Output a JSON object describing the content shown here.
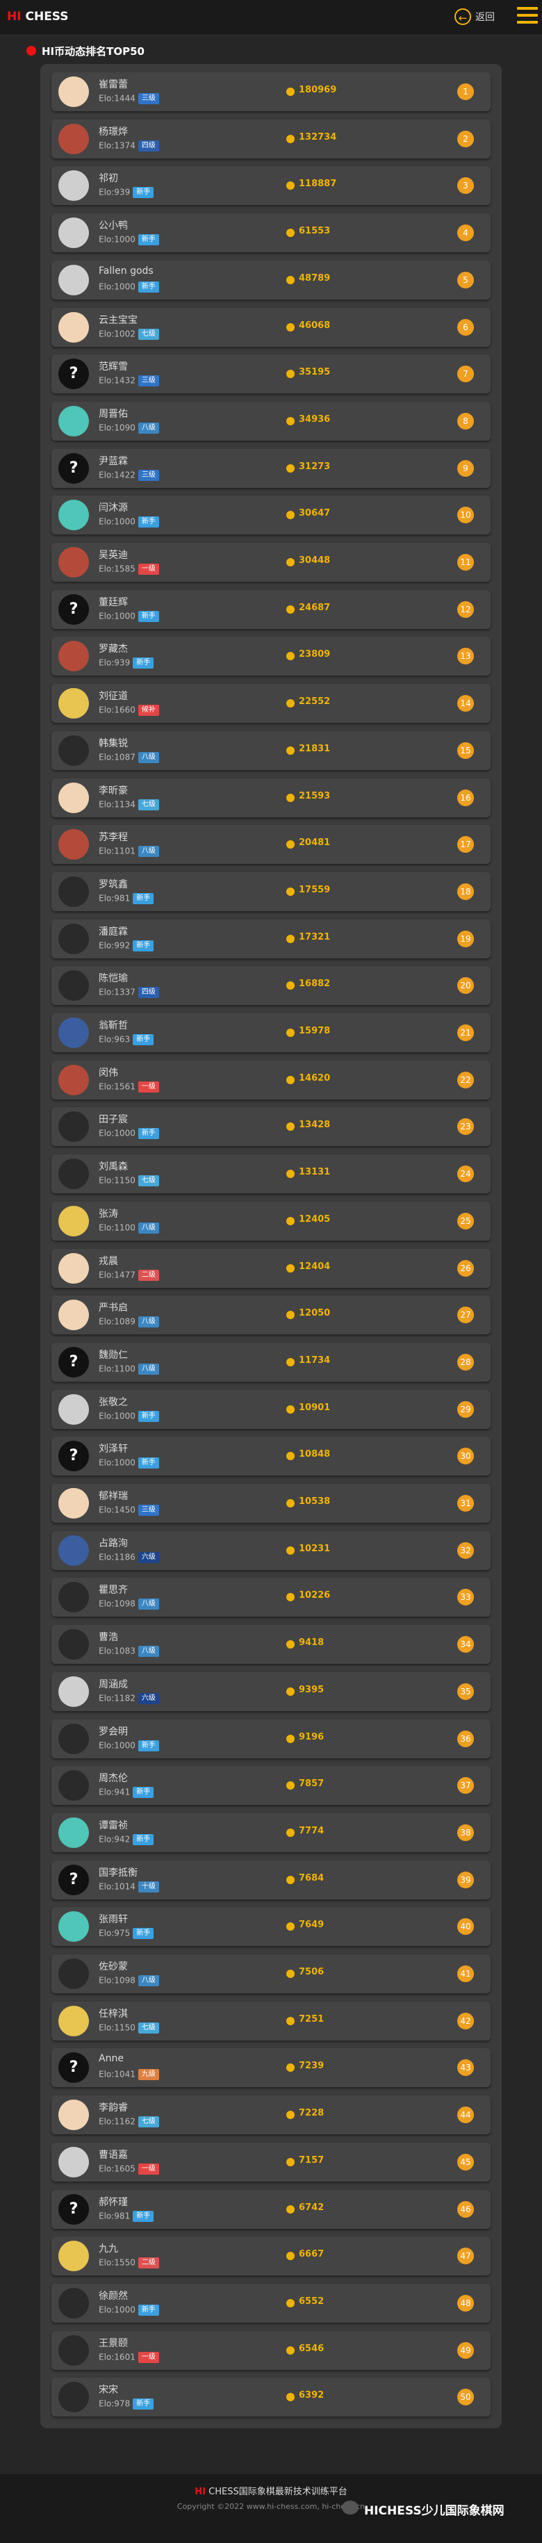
{
  "header": {
    "logo_hi": "HI",
    "logo_rest": "CHESS",
    "back_label": "返回",
    "back_icon": "back-arrow-icon",
    "menu_icon": "menu-icon"
  },
  "section": {
    "title": "HI币动态排名TOP50"
  },
  "players": [
    {
      "name": "崔雷蕾",
      "elo": "Elo:1444",
      "level": "三级",
      "score": "180969",
      "rank": "1"
    },
    {
      "name": "杨璟烨",
      "elo": "Elo:1374",
      "level": "四级",
      "score": "132734",
      "rank": "2"
    },
    {
      "name": "祁初",
      "elo": "Elo:939",
      "level": "新手",
      "score": "118887",
      "rank": "3"
    },
    {
      "name": "公小鸭",
      "elo": "Elo:1000",
      "level": "新手",
      "score": "61553",
      "rank": "4"
    },
    {
      "name": "Fallen gods",
      "elo": "Elo:1000",
      "level": "新手",
      "score": "48789",
      "rank": "5"
    },
    {
      "name": "云主宝宝",
      "elo": "Elo:1002",
      "level": "七级",
      "score": "46068",
      "rank": "6"
    },
    {
      "name": "范辉雪",
      "elo": "Elo:1432",
      "level": "三级",
      "score": "35195",
      "rank": "7"
    },
    {
      "name": "周晋佑",
      "elo": "Elo:1090",
      "level": "八级",
      "score": "34936",
      "rank": "8"
    },
    {
      "name": "尹蓝霖",
      "elo": "Elo:1422",
      "level": "三级",
      "score": "31273",
      "rank": "9"
    },
    {
      "name": "闫沐源",
      "elo": "Elo:1000",
      "level": "新手",
      "score": "30647",
      "rank": "10"
    },
    {
      "name": "吴英迪",
      "elo": "Elo:1585",
      "level": "一级",
      "score": "30448",
      "rank": "11"
    },
    {
      "name": "董廷辉",
      "elo": "Elo:1000",
      "level": "新手",
      "score": "24687",
      "rank": "12"
    },
    {
      "name": "罗藏杰",
      "elo": "Elo:939",
      "level": "新手",
      "score": "23809",
      "rank": "13"
    },
    {
      "name": "刘征道",
      "elo": "Elo:1660",
      "level": "候补",
      "score": "22552",
      "rank": "14"
    },
    {
      "name": "韩集锐",
      "elo": "Elo:1087",
      "level": "八级",
      "score": "21831",
      "rank": "15"
    },
    {
      "name": "李昕豪",
      "elo": "Elo:1134",
      "level": "七级",
      "score": "21593",
      "rank": "16"
    },
    {
      "name": "苏李程",
      "elo": "Elo:1101",
      "level": "八级",
      "score": "20481",
      "rank": "17"
    },
    {
      "name": "罗筑鑫",
      "elo": "Elo:981",
      "level": "新手",
      "score": "17559",
      "rank": "18"
    },
    {
      "name": "潘庭霖",
      "elo": "Elo:992",
      "level": "新手",
      "score": "17321",
      "rank": "19"
    },
    {
      "name": "陈恺瑜",
      "elo": "Elo:1337",
      "level": "四级",
      "score": "16882",
      "rank": "20"
    },
    {
      "name": "翁靳哲",
      "elo": "Elo:963",
      "level": "新手",
      "score": "15978",
      "rank": "21"
    },
    {
      "name": "闵伟",
      "elo": "Elo:1561",
      "level": "一级",
      "score": "14620",
      "rank": "22"
    },
    {
      "name": "田子宸",
      "elo": "Elo:1000",
      "level": "新手",
      "score": "13428",
      "rank": "23"
    },
    {
      "name": "刘禹森",
      "elo": "Elo:1150",
      "level": "七级",
      "score": "13131",
      "rank": "24"
    },
    {
      "name": "张涛",
      "elo": "Elo:1100",
      "level": "八级",
      "score": "12405",
      "rank": "25"
    },
    {
      "name": "戎晨",
      "elo": "Elo:1477",
      "level": "二级",
      "score": "12404",
      "rank": "26"
    },
    {
      "name": "严书启",
      "elo": "Elo:1089",
      "level": "八级",
      "score": "12050",
      "rank": "27"
    },
    {
      "name": "魏勋仁",
      "elo": "Elo:1100",
      "level": "八级",
      "score": "11734",
      "rank": "28"
    },
    {
      "name": "张敬之",
      "elo": "Elo:1000",
      "level": "新手",
      "score": "10901",
      "rank": "29"
    },
    {
      "name": "刘泽轩",
      "elo": "Elo:1000",
      "level": "新手",
      "score": "10848",
      "rank": "30"
    },
    {
      "name": "郁祥瑞",
      "elo": "Elo:1450",
      "level": "三级",
      "score": "10538",
      "rank": "31"
    },
    {
      "name": "占路洵",
      "elo": "Elo:1186",
      "level": "六级",
      "score": "10231",
      "rank": "32"
    },
    {
      "name": "瞿思齐",
      "elo": "Elo:1098",
      "level": "八级",
      "score": "10226",
      "rank": "33"
    },
    {
      "name": "曹浩",
      "elo": "Elo:1083",
      "level": "八级",
      "score": "9418",
      "rank": "34"
    },
    {
      "name": "周涵成",
      "elo": "Elo:1182",
      "level": "六级",
      "score": "9395",
      "rank": "35"
    },
    {
      "name": "罗会明",
      "elo": "Elo:1000",
      "level": "新手",
      "score": "9196",
      "rank": "36"
    },
    {
      "name": "周杰伦",
      "elo": "Elo:941",
      "level": "新手",
      "score": "7857",
      "rank": "37"
    },
    {
      "name": "谭雷祯",
      "elo": "Elo:942",
      "level": "新手",
      "score": "7774",
      "rank": "38"
    },
    {
      "name": "国李抵衡",
      "elo": "Elo:1014",
      "level": "十级",
      "score": "7684",
      "rank": "39"
    },
    {
      "name": "张雨轩",
      "elo": "Elo:975",
      "level": "新手",
      "score": "7649",
      "rank": "40"
    },
    {
      "name": "佐砂蒙",
      "elo": "Elo:1098",
      "level": "八级",
      "score": "7506",
      "rank": "41"
    },
    {
      "name": "任梓淇",
      "elo": "Elo:1150",
      "level": "七级",
      "score": "7251",
      "rank": "42"
    },
    {
      "name": "Anne",
      "elo": "Elo:1041",
      "level": "九级",
      "score": "7239",
      "rank": "43"
    },
    {
      "name": "李韵睿",
      "elo": "Elo:1162",
      "level": "七级",
      "score": "7228",
      "rank": "44"
    },
    {
      "name": "曹语嘉",
      "elo": "Elo:1605",
      "level": "一级",
      "score": "7157",
      "rank": "45"
    },
    {
      "name": "郝怀瑾",
      "elo": "Elo:981",
      "level": "新手",
      "score": "6742",
      "rank": "46"
    },
    {
      "name": "九九",
      "elo": "Elo:1550",
      "level": "二级",
      "score": "6667",
      "rank": "47"
    },
    {
      "name": "徐颜然",
      "elo": "Elo:1000",
      "level": "新手",
      "score": "6552",
      "rank": "48"
    },
    {
      "name": "王景颐",
      "elo": "Elo:1601",
      "level": "一级",
      "score": "6546",
      "rank": "49"
    },
    {
      "name": "宋宋",
      "elo": "Elo:978",
      "level": "新手",
      "score": "6392",
      "rank": "50"
    }
  ],
  "footer": {
    "brand_hi": "HI",
    "brand_rest": " CHESS国际象棋最新技术训练平台",
    "copyright": "Copyright ©2022 www.hi-chess.com, hi-chess.cn",
    "watermark": "HICHESS少儿国际象棋网"
  }
}
